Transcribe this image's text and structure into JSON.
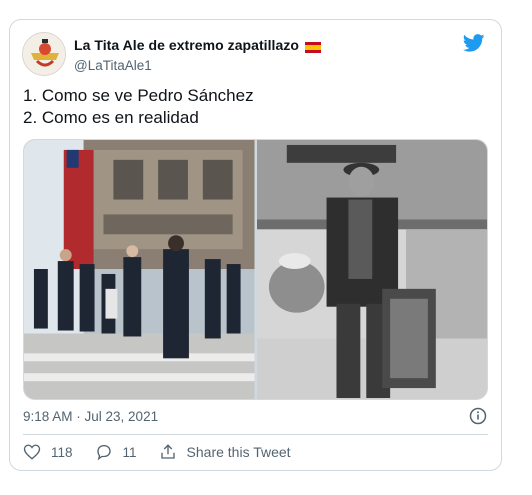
{
  "tweet": {
    "display_name": "La Tita Ale de extremo zapatillazo",
    "handle": "@LaTitaAle1",
    "text_lines": [
      "1. Como se ve Pedro Sánchez",
      "2. Como es en realidad"
    ],
    "timestamp": "9:18 AM · Jul 23, 2021",
    "likes": "118",
    "replies": "11",
    "share_label": "Share this Tweet"
  },
  "icons": {
    "brand": "twitter-bird-icon",
    "flag": "spain-flag-icon",
    "info": "info-icon",
    "like": "heart-icon",
    "reply": "reply-icon",
    "share": "share-icon"
  },
  "colors": {
    "twitter_blue": "#1d9bf0",
    "secondary_text": "#536471",
    "border": "#cfd9de"
  }
}
